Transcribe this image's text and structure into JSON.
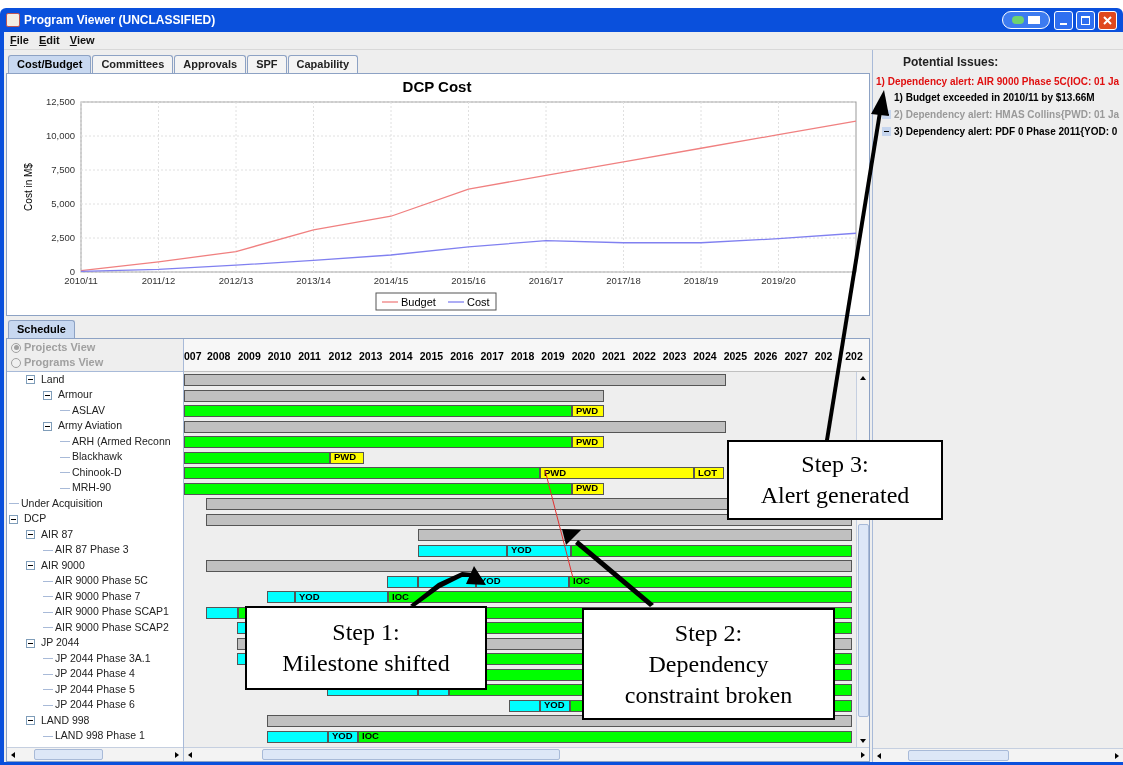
{
  "window": {
    "title": "Program Viewer (UNCLASSIFIED)"
  },
  "menu": [
    "File",
    "Edit",
    "View"
  ],
  "tabs": [
    {
      "label": "Cost/Budget",
      "selected": true
    },
    {
      "label": "Committees",
      "selected": false
    },
    {
      "label": "Approvals",
      "selected": false
    },
    {
      "label": "SPF",
      "selected": false
    },
    {
      "label": "Capability",
      "selected": false
    }
  ],
  "cost_chart": {
    "chart_data": {
      "type": "line",
      "title": "DCP Cost",
      "ylabel": "Cost in M$",
      "categories": [
        "2010/11",
        "2011/12",
        "2012/13",
        "2013/14",
        "2014/15",
        "2015/16",
        "2016/17",
        "2017/18",
        "2018/19",
        "2019/20",
        null
      ],
      "ylim": [
        0,
        12500
      ],
      "grid": true,
      "legend": true,
      "yticks": [
        {
          "value": 0,
          "label": "0"
        },
        {
          "value": 2500,
          "label": "2,500"
        },
        {
          "value": 5000,
          "label": "5,000"
        },
        {
          "value": 7500,
          "label": "7,500"
        },
        {
          "value": 10000,
          "label": "10,000"
        },
        {
          "value": 12500,
          "label": "12,500"
        }
      ],
      "series": [
        {
          "name": "Budget",
          "color": "#f08080",
          "values": [
            100,
            750,
            1500,
            3100,
            4100,
            6100,
            7100,
            8100,
            9100,
            10100,
            11100
          ]
        },
        {
          "name": "Cost",
          "color": "#8080f0",
          "values": [
            50,
            200,
            500,
            850,
            1250,
            1850,
            2300,
            2150,
            2150,
            2450,
            2850
          ]
        }
      ]
    }
  },
  "schedule": {
    "tab": {
      "label": "Schedule",
      "selected": true
    },
    "views": [
      {
        "label": "Projects View",
        "selected": true,
        "disabled": true
      },
      {
        "label": "Programs View",
        "selected": false,
        "disabled": true
      }
    ],
    "tree": {
      "scrolled_branch": [
        {
          "label": "Land",
          "expanded": true,
          "children": [
            {
              "label": "Armour",
              "expanded": true,
              "children": [
                {
                  "label": "ASLAV"
                }
              ]
            },
            {
              "label": "Army Aviation",
              "expanded": true,
              "children": [
                {
                  "label": "ARH (Armed Reconn"
                },
                {
                  "label": "Blackhawk"
                },
                {
                  "label": "Chinook-D"
                },
                {
                  "label": "MRH-90"
                }
              ]
            }
          ]
        }
      ],
      "nodes": [
        {
          "label": "Under Acquisition"
        },
        {
          "label": "DCP",
          "expanded": true,
          "children": [
            {
              "label": "AIR 87",
              "expanded": true,
              "children": [
                {
                  "label": "AIR 87 Phase 3"
                }
              ]
            },
            {
              "label": "AIR 9000",
              "expanded": true,
              "children": [
                {
                  "label": "AIR 9000 Phase 5C"
                },
                {
                  "label": "AIR 9000 Phase 7"
                },
                {
                  "label": "AIR 9000 Phase SCAP1"
                },
                {
                  "label": "AIR 9000 Phase SCAP2"
                }
              ]
            },
            {
              "label": "JP 2044",
              "expanded": true,
              "children": [
                {
                  "label": "JP 2044 Phase 3A.1"
                },
                {
                  "label": "JP 2044 Phase 4"
                },
                {
                  "label": "JP 2044 Phase 5"
                },
                {
                  "label": "JP 2044 Phase 6"
                }
              ]
            },
            {
              "label": "LAND 998",
              "expanded": true,
              "children": [
                {
                  "label": "LAND 998 Phase 1"
                }
              ]
            }
          ]
        }
      ]
    },
    "years": [
      "007",
      "2008",
      "2009",
      "2010",
      "2011",
      "2012",
      "2013",
      "2014",
      "2015",
      "2016",
      "2017",
      "2018",
      "2019",
      "2020",
      "2021",
      "2022",
      "2023",
      "2024",
      "2025",
      "2026",
      "2027",
      "202",
      "202"
    ],
    "rows": [
      {
        "segments": [
          {
            "kind": "summary"
          }
        ]
      },
      {
        "segments": [
          {
            "kind": "summary"
          }
        ]
      },
      {
        "segments": [
          {
            "kind": "done"
          },
          {
            "kind": "milestone",
            "label": "PWD"
          }
        ]
      },
      {
        "segments": [
          {
            "kind": "summary"
          }
        ]
      },
      {
        "segments": [
          {
            "kind": "done"
          },
          {
            "kind": "milestone",
            "label": "PWD"
          }
        ]
      },
      {
        "segments": [
          {
            "kind": "done"
          },
          {
            "kind": "milestone",
            "label": "PWD"
          }
        ]
      },
      {
        "segments": [
          {
            "kind": "done"
          },
          {
            "kind": "milestone",
            "label": "PWD"
          },
          {
            "kind": "milestone",
            "label": "LOT"
          }
        ]
      },
      {
        "segments": [
          {
            "kind": "done"
          },
          {
            "kind": "milestone",
            "label": "PWD"
          }
        ]
      },
      {
        "segments": [
          {
            "kind": "summary"
          }
        ]
      },
      {
        "segments": [
          {
            "kind": "summary"
          }
        ]
      },
      {
        "segments": [
          {
            "kind": "summary"
          }
        ]
      },
      {
        "segments": [
          {
            "kind": "phase"
          },
          {
            "kind": "phase",
            "label": "YOD"
          },
          {
            "kind": "done"
          }
        ]
      },
      {
        "segments": [
          {
            "kind": "summary"
          }
        ]
      },
      {
        "segments": [
          {
            "kind": "phase"
          },
          {
            "kind": "phase"
          },
          {
            "kind": "phase",
            "label": "YOD"
          },
          {
            "kind": "done",
            "label": "IOC"
          }
        ]
      },
      {
        "segments": [
          {
            "kind": "phase"
          },
          {
            "kind": "phase",
            "label": "YOD"
          },
          {
            "kind": "done",
            "label": "IOC"
          }
        ]
      },
      {
        "segments": [
          {
            "kind": "phase"
          },
          {
            "kind": "done"
          }
        ]
      },
      {
        "segments": [
          {
            "kind": "phase"
          },
          {
            "kind": "done"
          }
        ]
      },
      {
        "segments": [
          {
            "kind": "summary"
          }
        ]
      },
      {
        "segments": [
          {
            "kind": "phase"
          },
          {
            "kind": "done"
          }
        ]
      },
      {
        "segments": [
          {
            "kind": "done"
          }
        ]
      },
      {
        "segments": [
          {
            "kind": "phase"
          },
          {
            "kind": "phase"
          },
          {
            "kind": "done"
          }
        ]
      },
      {
        "segments": [
          {
            "kind": "phase"
          },
          {
            "kind": "phase",
            "label": "YOD"
          },
          {
            "kind": "done"
          }
        ]
      },
      {
        "segments": [
          {
            "kind": "summary"
          }
        ]
      },
      {
        "segments": [
          {
            "kind": "phase"
          },
          {
            "kind": "phase",
            "label": "YOD"
          },
          {
            "kind": "done",
            "label": "IOC"
          }
        ]
      }
    ]
  },
  "issues": {
    "title": "Potential Issues:",
    "items": [
      {
        "text": "1) Dependency alert: AIR 9000 Phase 5C(IOC: 01 Ja",
        "color": "#e01010",
        "children": [
          {
            "text": "1) Budget exceeded in 2010/11 by $13.66M",
            "color": "#000000",
            "handle": false
          },
          {
            "text": "2) Dependency alert: HMAS Collins{PWD: 01 Ja",
            "color": "#999999",
            "handle": true
          },
          {
            "text": "3) Dependency alert: PDF 0 Phase 2011{YOD: 0",
            "color": "#000000",
            "handle": true
          }
        ]
      }
    ]
  },
  "callouts": [
    {
      "text": "Step 1:\nMilestone shifted"
    },
    {
      "text": "Step 2:\nDependency\nconstraint broken"
    },
    {
      "text": "Step 3:\nAlert generated"
    }
  ]
}
